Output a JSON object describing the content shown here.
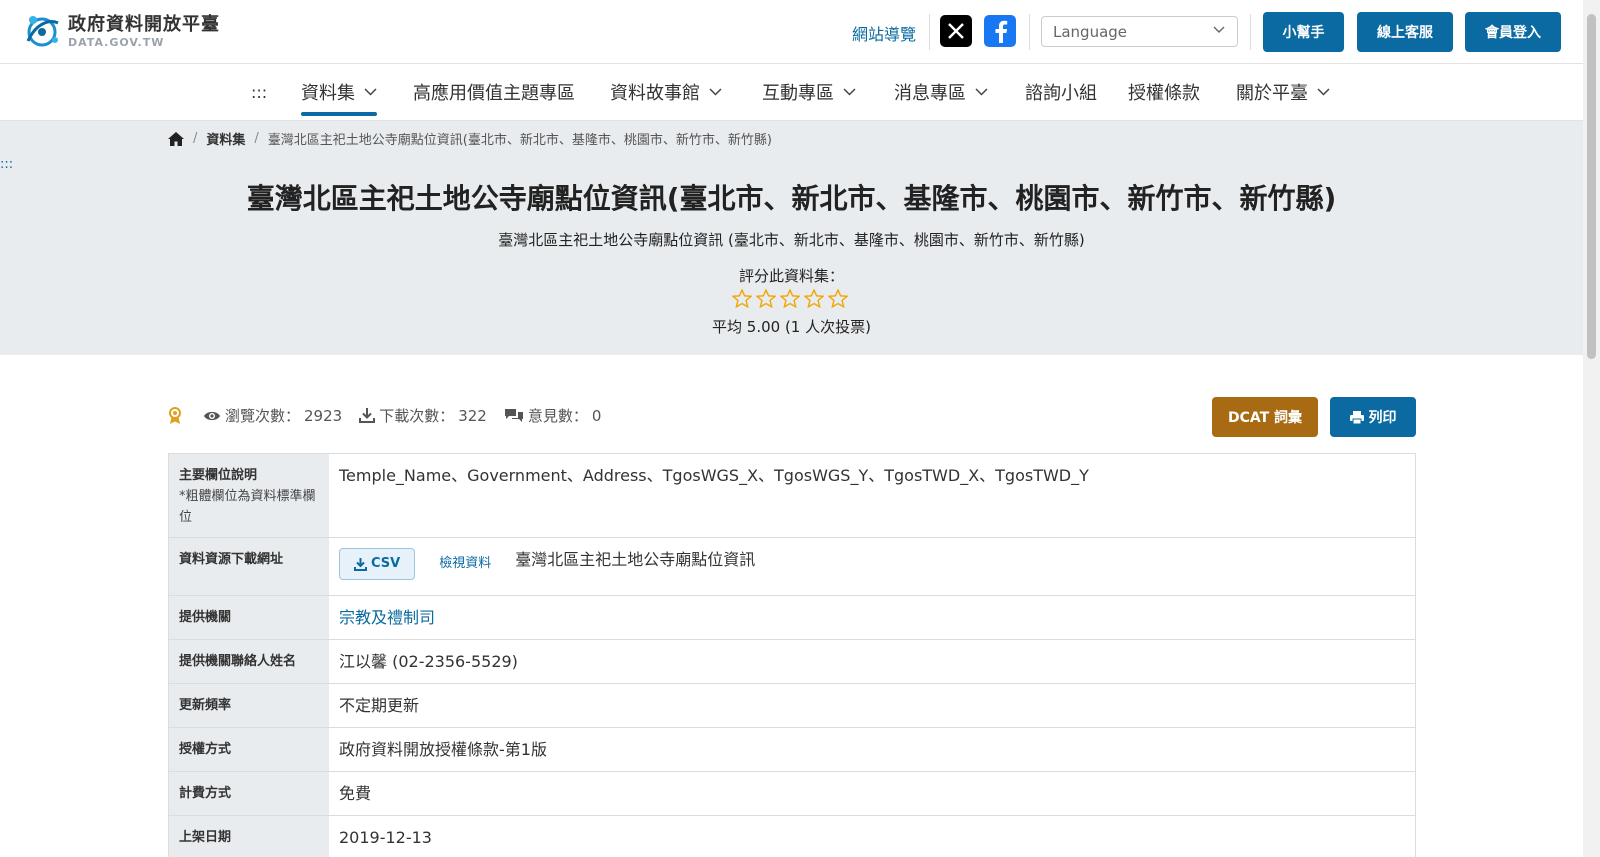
{
  "header": {
    "logo_cn": "政府資料開放平臺",
    "logo_en": "DATA.GOV.TW",
    "sitemap": "網站導覽",
    "social": [
      "x-icon",
      "facebook-icon"
    ],
    "language_placeholder": "Language",
    "buttons": {
      "helper": "小幫手",
      "support": "線上客服",
      "login": "會員登入"
    }
  },
  "nav": {
    "accessKey": ":::",
    "items": [
      {
        "label": "資料集",
        "dropdown": true,
        "active": true
      },
      {
        "label": "高應用價值主題專區",
        "dropdown": false
      },
      {
        "label": "資料故事館",
        "dropdown": true
      },
      {
        "label": "互動專區",
        "dropdown": true
      },
      {
        "label": "消息專區",
        "dropdown": true
      },
      {
        "label": "諮詢小組",
        "dropdown": false
      },
      {
        "label": "授權條款",
        "dropdown": false
      },
      {
        "label": "關於平臺",
        "dropdown": true
      }
    ]
  },
  "breadcrumb": {
    "section": "資料集",
    "current": "臺灣北區主祀土地公寺廟點位資訊(臺北市、新北市、基隆市、桃園市、新竹市、新竹縣)"
  },
  "side_access": ":::",
  "dataset": {
    "title": "臺灣北區主祀土地公寺廟點位資訊(臺北市、新北市、基隆市、桃園市、新竹市、新竹縣)",
    "subtitle": "臺灣北區主祀土地公寺廟點位資訊 (臺北市、新北市、基隆市、桃園市、新竹市、新竹縣)",
    "rate_label": "評分此資料集：",
    "rating_stars": 5,
    "rating_average": "平均 5.00 (1 人次投票)"
  },
  "stats": {
    "views_label": "瀏覽次數：",
    "views": "2923",
    "downloads_label": "下載次數：",
    "downloads": "322",
    "comments_label": "意見數：",
    "comments": "0"
  },
  "actions": {
    "dcat": "DCAT 詞彙",
    "print": "列印"
  },
  "colors": {
    "primary": "#0a6aa1",
    "dcat": "#a86a12",
    "hero_bg": "#e9ecef",
    "star": "#f0a500"
  },
  "info": {
    "fields_key": "主要欄位說明",
    "fields_note": "*粗體欄位為資料標準欄位",
    "fields_value": "Temple_Name、Government、Address、TgosWGS_X、TgosWGS_Y、TgosTWD_X、TgosTWD_Y",
    "resource_key": "資料資源下載網址",
    "resource_format": "CSV",
    "resource_view": "檢視資料",
    "resource_name": "臺灣北區主祀土地公寺廟點位資訊",
    "provider_key": "提供機關",
    "provider_value": "宗教及禮制司",
    "contact_key": "提供機關聯絡人姓名",
    "contact_value": "江以馨 (02-2356-5529)",
    "frequency_key": "更新頻率",
    "frequency_value": "不定期更新",
    "license_key": "授權方式",
    "license_value": "政府資料開放授權條款-第1版",
    "fee_key": "計費方式",
    "fee_value": "免費",
    "date_key": "上架日期",
    "date_value": "2019-12-13"
  }
}
